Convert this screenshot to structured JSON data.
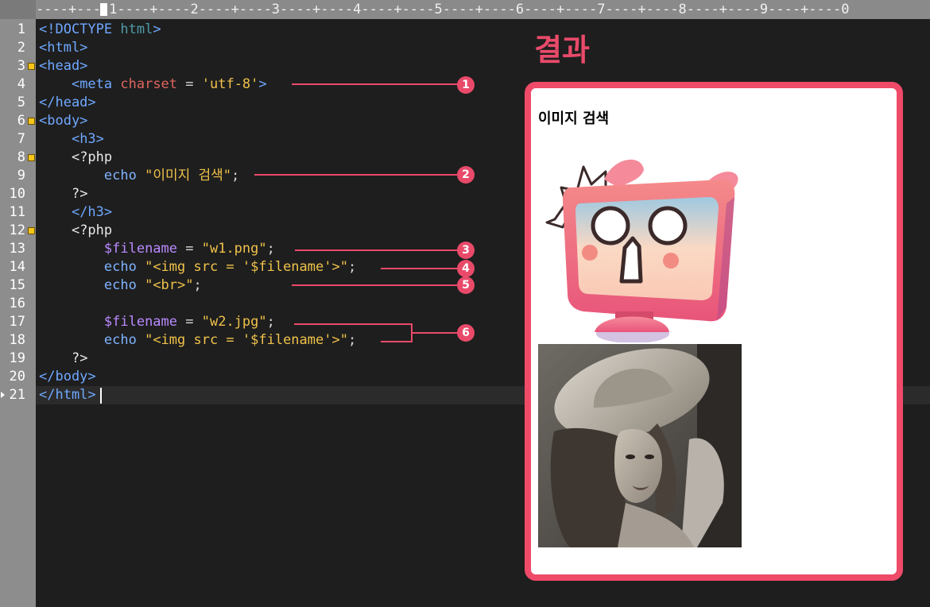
{
  "ruler": {
    "text": "----+----1----+----2----+----3----+----4----+----5----+----6----+----7----+----8----+----9----+----0"
  },
  "gutter": {
    "line_numbers": [
      "1",
      "2",
      "3",
      "4",
      "5",
      "6",
      "7",
      "8",
      "9",
      "10",
      "11",
      "12",
      "13",
      "14",
      "15",
      "16",
      "17",
      "18",
      "19",
      "20",
      "21"
    ],
    "fold_lines": [
      3,
      6,
      8,
      12
    ],
    "current_line": 21
  },
  "code": {
    "l1": {
      "a": "<!DOCTYPE ",
      "b": "html",
      "c": ">"
    },
    "l2": {
      "a": "<html>"
    },
    "l3": {
      "a": "<head>"
    },
    "l4": {
      "a": "<meta ",
      "b": "charset",
      "c": " = ",
      "d": "'utf-8'",
      "e": ">"
    },
    "l5": {
      "a": "</head>"
    },
    "l6": {
      "a": "<body>"
    },
    "l7": {
      "a": "<h3>"
    },
    "l8": {
      "a": "<?php"
    },
    "l9": {
      "a": "echo ",
      "b": "\"이미지 검색\"",
      "c": ";"
    },
    "l10": {
      "a": "?>"
    },
    "l11": {
      "a": "</h3>"
    },
    "l12": {
      "a": "<?php"
    },
    "l13": {
      "a": "$filename",
      "b": " = ",
      "c": "\"w1.png\"",
      "d": ";"
    },
    "l14": {
      "a": "echo ",
      "b": "\"<img src = '$filename'>\"",
      "c": ";"
    },
    "l15": {
      "a": "echo ",
      "b": "\"<br>\"",
      "c": ";"
    },
    "l17": {
      "a": "$filename",
      "b": " = ",
      "c": "\"w2.jpg\"",
      "d": ";"
    },
    "l18": {
      "a": "echo ",
      "b": "\"<img src = '$filename'>\"",
      "c": ";"
    },
    "l19": {
      "a": "?>"
    },
    "l20": {
      "a": "</body>"
    },
    "l21": {
      "a": "</html>"
    }
  },
  "annotations": [
    "1",
    "2",
    "3",
    "4",
    "5",
    "6"
  ],
  "result": {
    "title": "결과",
    "heading": "이미지 검색",
    "images": [
      "tv-character-image",
      "woman-in-hat-photo"
    ]
  },
  "colors": {
    "accent": "#e94a6a",
    "editor_bg": "#1e1e1e",
    "tag": "#6fa8ff",
    "string": "#f0c24a",
    "attribute": "#e0655d",
    "variable": "#b98aff"
  }
}
